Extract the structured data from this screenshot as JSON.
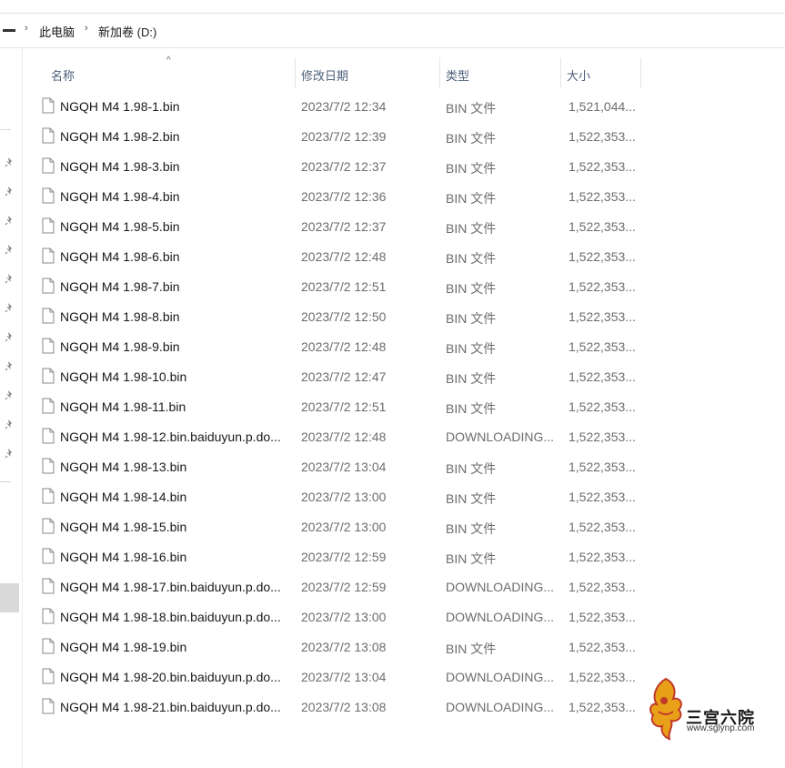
{
  "breadcrumb": {
    "items": [
      "此电脑",
      "新加卷 (D:)"
    ]
  },
  "columns": {
    "name": "名称",
    "date": "修改日期",
    "type": "类型",
    "size": "大小"
  },
  "files": [
    {
      "name": "NGQH M4 1.98-1.bin",
      "date": "2023/7/2 12:34",
      "type": "BIN 文件",
      "size": "1,521,044..."
    },
    {
      "name": "NGQH M4 1.98-2.bin",
      "date": "2023/7/2 12:39",
      "type": "BIN 文件",
      "size": "1,522,353..."
    },
    {
      "name": "NGQH M4 1.98-3.bin",
      "date": "2023/7/2 12:37",
      "type": "BIN 文件",
      "size": "1,522,353..."
    },
    {
      "name": "NGQH M4 1.98-4.bin",
      "date": "2023/7/2 12:36",
      "type": "BIN 文件",
      "size": "1,522,353..."
    },
    {
      "name": "NGQH M4 1.98-5.bin",
      "date": "2023/7/2 12:37",
      "type": "BIN 文件",
      "size": "1,522,353..."
    },
    {
      "name": "NGQH M4 1.98-6.bin",
      "date": "2023/7/2 12:48",
      "type": "BIN 文件",
      "size": "1,522,353..."
    },
    {
      "name": "NGQH M4 1.98-7.bin",
      "date": "2023/7/2 12:51",
      "type": "BIN 文件",
      "size": "1,522,353..."
    },
    {
      "name": "NGQH M4 1.98-8.bin",
      "date": "2023/7/2 12:50",
      "type": "BIN 文件",
      "size": "1,522,353..."
    },
    {
      "name": "NGQH M4 1.98-9.bin",
      "date": "2023/7/2 12:48",
      "type": "BIN 文件",
      "size": "1,522,353..."
    },
    {
      "name": "NGQH M4 1.98-10.bin",
      "date": "2023/7/2 12:47",
      "type": "BIN 文件",
      "size": "1,522,353..."
    },
    {
      "name": "NGQH M4 1.98-11.bin",
      "date": "2023/7/2 12:51",
      "type": "BIN 文件",
      "size": "1,522,353..."
    },
    {
      "name": "NGQH M4 1.98-12.bin.baiduyun.p.do...",
      "date": "2023/7/2 12:48",
      "type": "DOWNLOADING...",
      "size": "1,522,353..."
    },
    {
      "name": "NGQH M4 1.98-13.bin",
      "date": "2023/7/2 13:04",
      "type": "BIN 文件",
      "size": "1,522,353..."
    },
    {
      "name": "NGQH M4 1.98-14.bin",
      "date": "2023/7/2 13:00",
      "type": "BIN 文件",
      "size": "1,522,353..."
    },
    {
      "name": "NGQH M4 1.98-15.bin",
      "date": "2023/7/2 13:00",
      "type": "BIN 文件",
      "size": "1,522,353..."
    },
    {
      "name": "NGQH M4 1.98-16.bin",
      "date": "2023/7/2 12:59",
      "type": "BIN 文件",
      "size": "1,522,353..."
    },
    {
      "name": "NGQH M4 1.98-17.bin.baiduyun.p.do...",
      "date": "2023/7/2 12:59",
      "type": "DOWNLOADING...",
      "size": "1,522,353..."
    },
    {
      "name": "NGQH M4 1.98-18.bin.baiduyun.p.do...",
      "date": "2023/7/2 13:00",
      "type": "DOWNLOADING...",
      "size": "1,522,353..."
    },
    {
      "name": "NGQH M4 1.98-19.bin",
      "date": "2023/7/2 13:08",
      "type": "BIN 文件",
      "size": "1,522,353..."
    },
    {
      "name": "NGQH M4 1.98-20.bin.baiduyun.p.do...",
      "date": "2023/7/2 13:04",
      "type": "DOWNLOADING...",
      "size": "1,522,353..."
    },
    {
      "name": "NGQH M4 1.98-21.bin.baiduyun.p.do...",
      "date": "2023/7/2 13:08",
      "type": "DOWNLOADING...",
      "size": "1,522,353..."
    }
  ],
  "watermark": {
    "name": "三宫六院",
    "url": "www.sglynp.com"
  },
  "icons": {
    "file": "blank-file-icon",
    "pin": "pin-icon",
    "sort": "sort-ascending-caret-icon",
    "chevron": "chevron-right-icon",
    "logo": "phoenix-logo"
  },
  "colors": {
    "header_text": "#4c607a",
    "row_text": "#1a1a1a",
    "secondary_text": "#6d6d6d"
  }
}
